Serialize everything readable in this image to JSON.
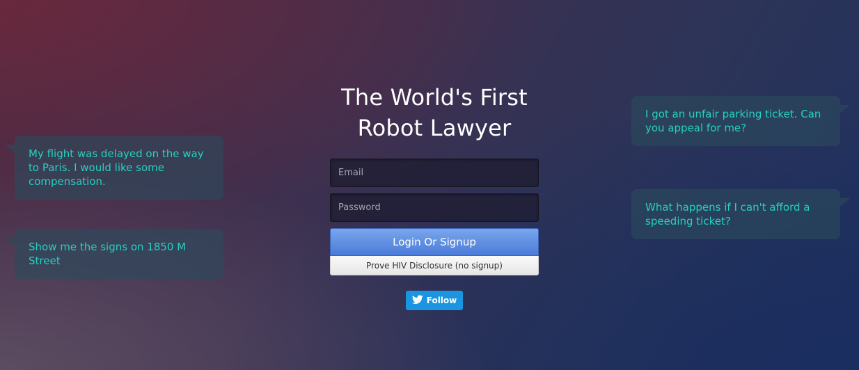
{
  "title_line1": "The World's First",
  "title_line2": "Robot Lawyer",
  "form": {
    "email_placeholder": "Email",
    "password_placeholder": "Password",
    "login_label": "Login Or Signup",
    "hiv_label": "Prove HIV Disclosure (no signup)"
  },
  "twitter": {
    "follow_label": "Follow",
    "icon": "twitter-bird-icon",
    "color": "#1b95e0"
  },
  "bubbles": {
    "left": [
      "My flight was delayed on the way to Paris. I would like some compensation.",
      "Show me the signs on 1850 M Street"
    ],
    "right": [
      "I got an unfair parking ticket. Can you appeal for me?",
      "What happens if I can't afford a speeding ticket?"
    ]
  },
  "colors": {
    "bubble_text": "#26d0c0",
    "login_button": "#5a8ae0"
  }
}
